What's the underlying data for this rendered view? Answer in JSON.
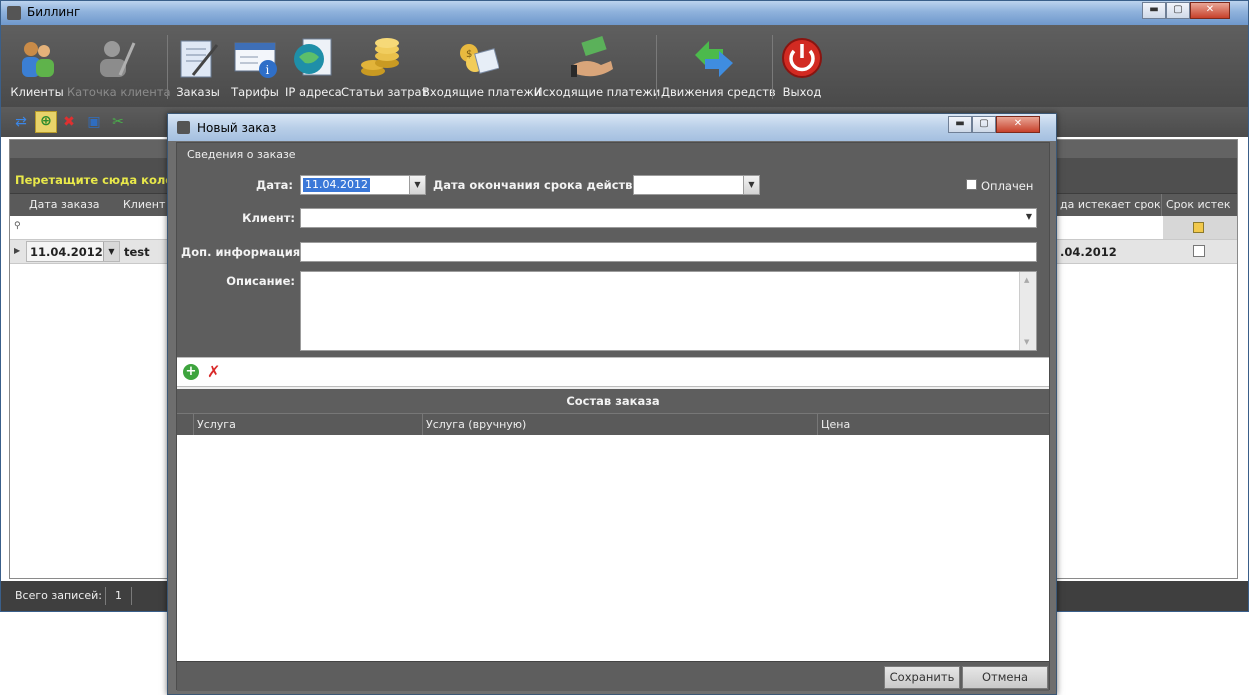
{
  "main": {
    "title": "Биллинг",
    "window_buttons": {
      "minimize": "▬",
      "maximize": "▢",
      "close": "✕"
    },
    "toolbar": [
      {
        "label": "Клиенты",
        "icon": "clients-icon",
        "enabled": true
      },
      {
        "label": "Каточка клиента",
        "icon": "client-card-icon",
        "enabled": false
      },
      {
        "label": "Заказы",
        "icon": "orders-icon",
        "enabled": true
      },
      {
        "label": "Тарифы",
        "icon": "tariffs-icon",
        "enabled": true
      },
      {
        "label": "IP адреса",
        "icon": "ip-globe-icon",
        "enabled": true
      },
      {
        "label": "Статьи затрат",
        "icon": "coins-icon",
        "enabled": true
      },
      {
        "label": "Входящие платежи",
        "icon": "incoming-payments-icon",
        "enabled": true
      },
      {
        "label": "Исходящие платежи",
        "icon": "outgoing-payments-icon",
        "enabled": true
      },
      {
        "label": "Движения средств",
        "icon": "money-flow-icon",
        "enabled": true
      },
      {
        "label": "Выход",
        "icon": "power-icon",
        "enabled": true
      }
    ],
    "grid": {
      "group_hint": "Перетащите сюда колонк",
      "columns": {
        "order_date": "Дата заказа",
        "client": "Клиент",
        "expires": "да истекает срок",
        "expired": "Срок истек"
      },
      "row": {
        "order_date": "11.04.2012",
        "client": "test",
        "expires": ".04.2012"
      }
    },
    "status": {
      "label": "Всего записей:",
      "count": "1"
    }
  },
  "dialog": {
    "title": "Новый заказ",
    "window_buttons": {
      "minimize": "▬",
      "maximize": "▢",
      "close": "✕"
    },
    "section_title": "Сведения о заказе",
    "fields": {
      "date_label": "Дата:",
      "date_value": "11.04.2012",
      "expiry_label": "Дата окончания срока действия:",
      "expiry_value": "",
      "paid_label": "Оплачен",
      "client_label": "Клиент:",
      "client_value": "",
      "extra_label": "Доп. информация:",
      "extra_value": "",
      "description_label": "Описание:",
      "description_value": ""
    },
    "composition_title": "Состав заказа",
    "composition_columns": [
      "Услуга",
      "Услуга (вручную)",
      "Цена"
    ],
    "buttons": {
      "save": "Сохранить",
      "cancel": "Отмена"
    }
  },
  "colors": {
    "toolbar_bg": "#4f4f4f",
    "hint_yellow": "#e8e84a",
    "selection_blue": "#3b78d8",
    "title_gradient": "#a4bfe0"
  }
}
